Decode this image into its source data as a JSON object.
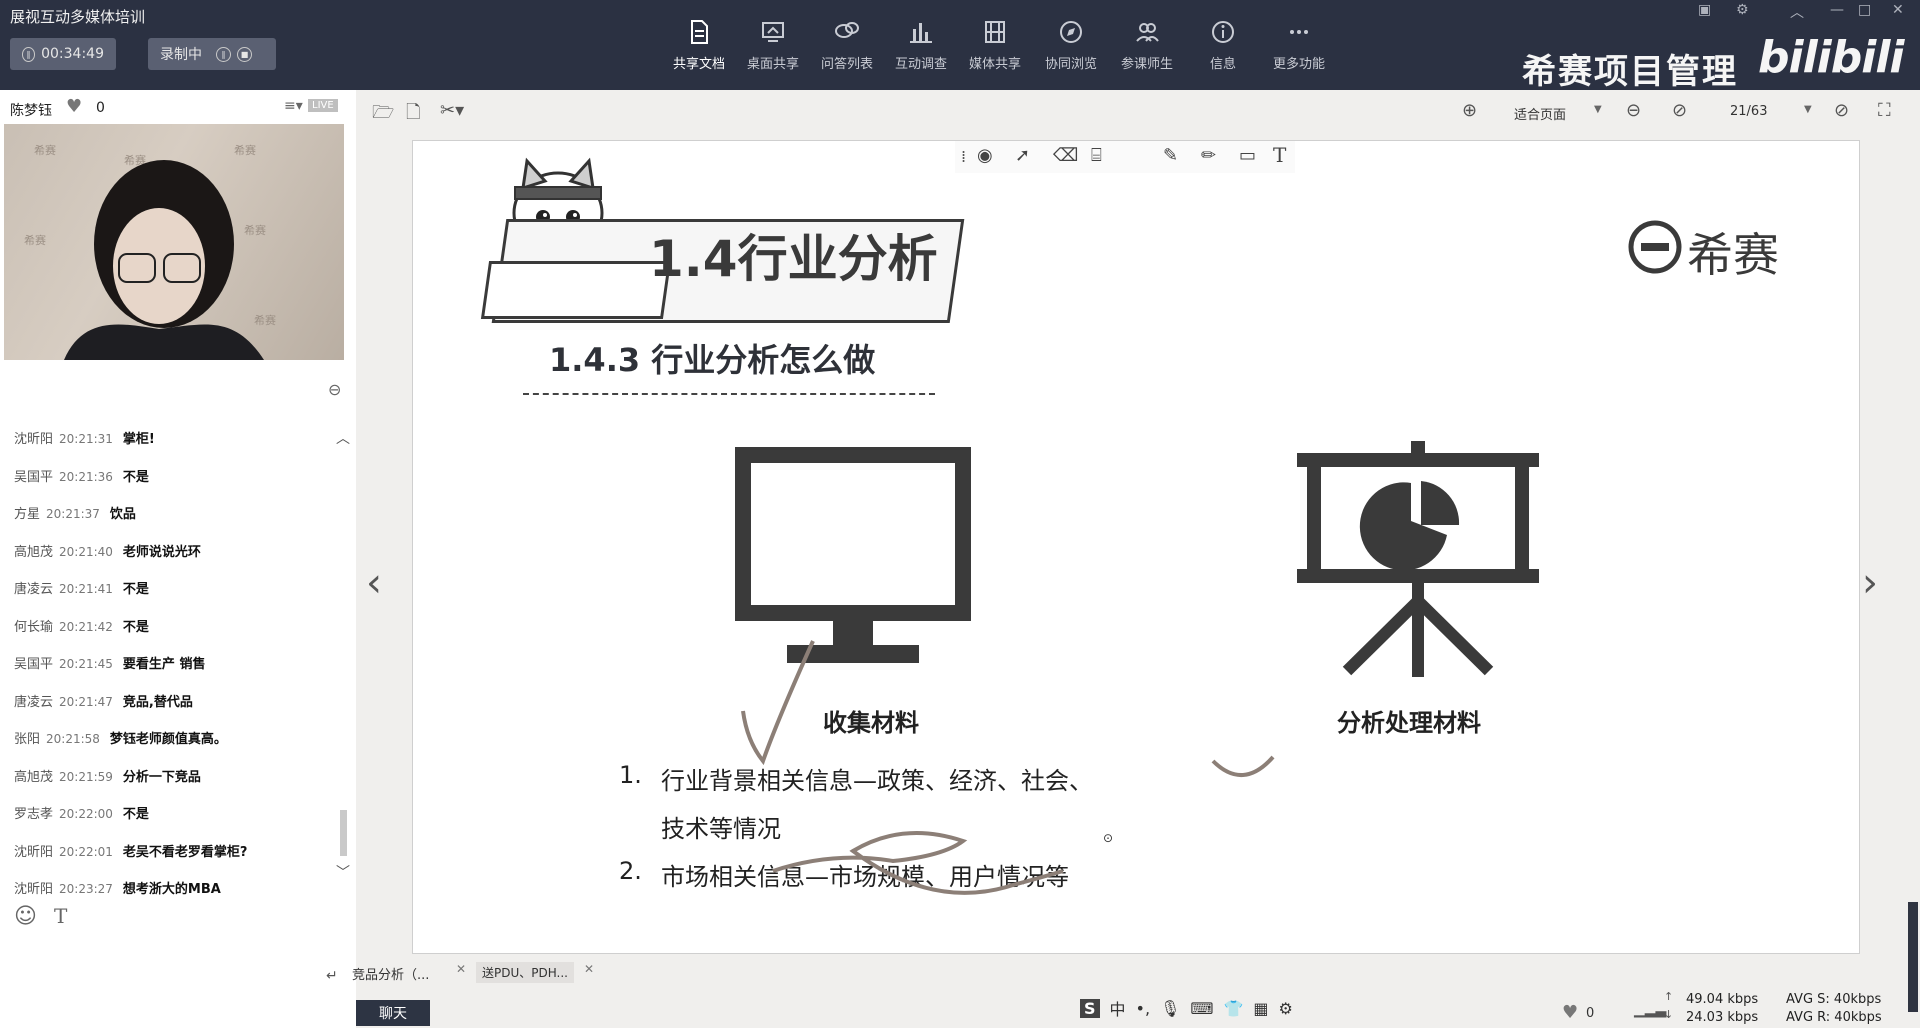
{
  "app": {
    "title": "展视互动多媒体培训"
  },
  "timer": {
    "value": "00:34:49"
  },
  "record": {
    "label": "录制中"
  },
  "nav": [
    {
      "label": "共享文档",
      "icon": "document-icon"
    },
    {
      "label": "桌面共享",
      "icon": "monitor-share-icon"
    },
    {
      "label": "问答列表",
      "icon": "chat-bubbles-icon"
    },
    {
      "label": "互动调查",
      "icon": "bar-chart-icon"
    },
    {
      "label": "媒体共享",
      "icon": "film-icon"
    },
    {
      "label": "协同浏览",
      "icon": "compass-icon"
    },
    {
      "label": "参课师生",
      "icon": "users-icon"
    },
    {
      "label": "信息",
      "icon": "info-icon"
    },
    {
      "label": "更多功能",
      "icon": "more-icon"
    }
  ],
  "brand": {
    "text": "希赛项目管理",
    "bili": "bilibili"
  },
  "user": {
    "name": "陈梦钰",
    "likes": "0",
    "live": "LIVE"
  },
  "chat": [
    {
      "name": "沈昕阳",
      "time": "20:21:31",
      "msg": "掌柜!"
    },
    {
      "name": "吴国平",
      "time": "20:21:36",
      "msg": "不是"
    },
    {
      "name": "方星",
      "time": "20:21:37",
      "msg": "饮品"
    },
    {
      "name": "高旭茂",
      "time": "20:21:40",
      "msg": "老师说说光环"
    },
    {
      "name": "唐凌云",
      "time": "20:21:41",
      "msg": "不是"
    },
    {
      "name": "何长瑜",
      "time": "20:21:42",
      "msg": "不是"
    },
    {
      "name": "吴国平",
      "time": "20:21:45",
      "msg": "要看生产  销售"
    },
    {
      "name": "唐凌云",
      "time": "20:21:47",
      "msg": "竞品,替代品"
    },
    {
      "name": "张阳",
      "time": "20:21:58",
      "msg": "梦钰老师颜值真高。"
    },
    {
      "name": "高旭茂",
      "time": "20:21:59",
      "msg": "分析一下竞品"
    },
    {
      "name": "罗志孝",
      "time": "20:22:00",
      "msg": "不是"
    },
    {
      "name": "沈昕阳",
      "time": "20:22:01",
      "msg": "老吴不看老罗看掌柜?"
    },
    {
      "name": "沈昕阳",
      "time": "20:23:27",
      "msg": "想考浙大的MBA"
    }
  ],
  "doc": {
    "fit": "适合页面",
    "page": "21/63"
  },
  "slide": {
    "title": "1.4行业分析",
    "subtitle": "1.4.3 行业分析怎么做",
    "logo": "希赛",
    "label_left": "收集材料",
    "label_right": "分析处理材料",
    "item1_num": "1.",
    "item1_line1": "行业背景相关信息—政策、经济、社会、",
    "item1_line2": "技术等情况",
    "item2_num": "2.",
    "item2_line1": "市场相关信息—市场规模、用户情况等"
  },
  "tabs": [
    {
      "label": "竞品分析（..."
    },
    {
      "label": "送PDU、PDH..."
    }
  ],
  "chat_tab": {
    "label": "聊天"
  },
  "status": {
    "likes": "0",
    "up": "49.04 kbps",
    "down": "24.03 kbps",
    "avg_s": "AVG S: 40kbps",
    "avg_r": "AVG R: 40kbps"
  },
  "ime": {
    "lang": "中"
  }
}
